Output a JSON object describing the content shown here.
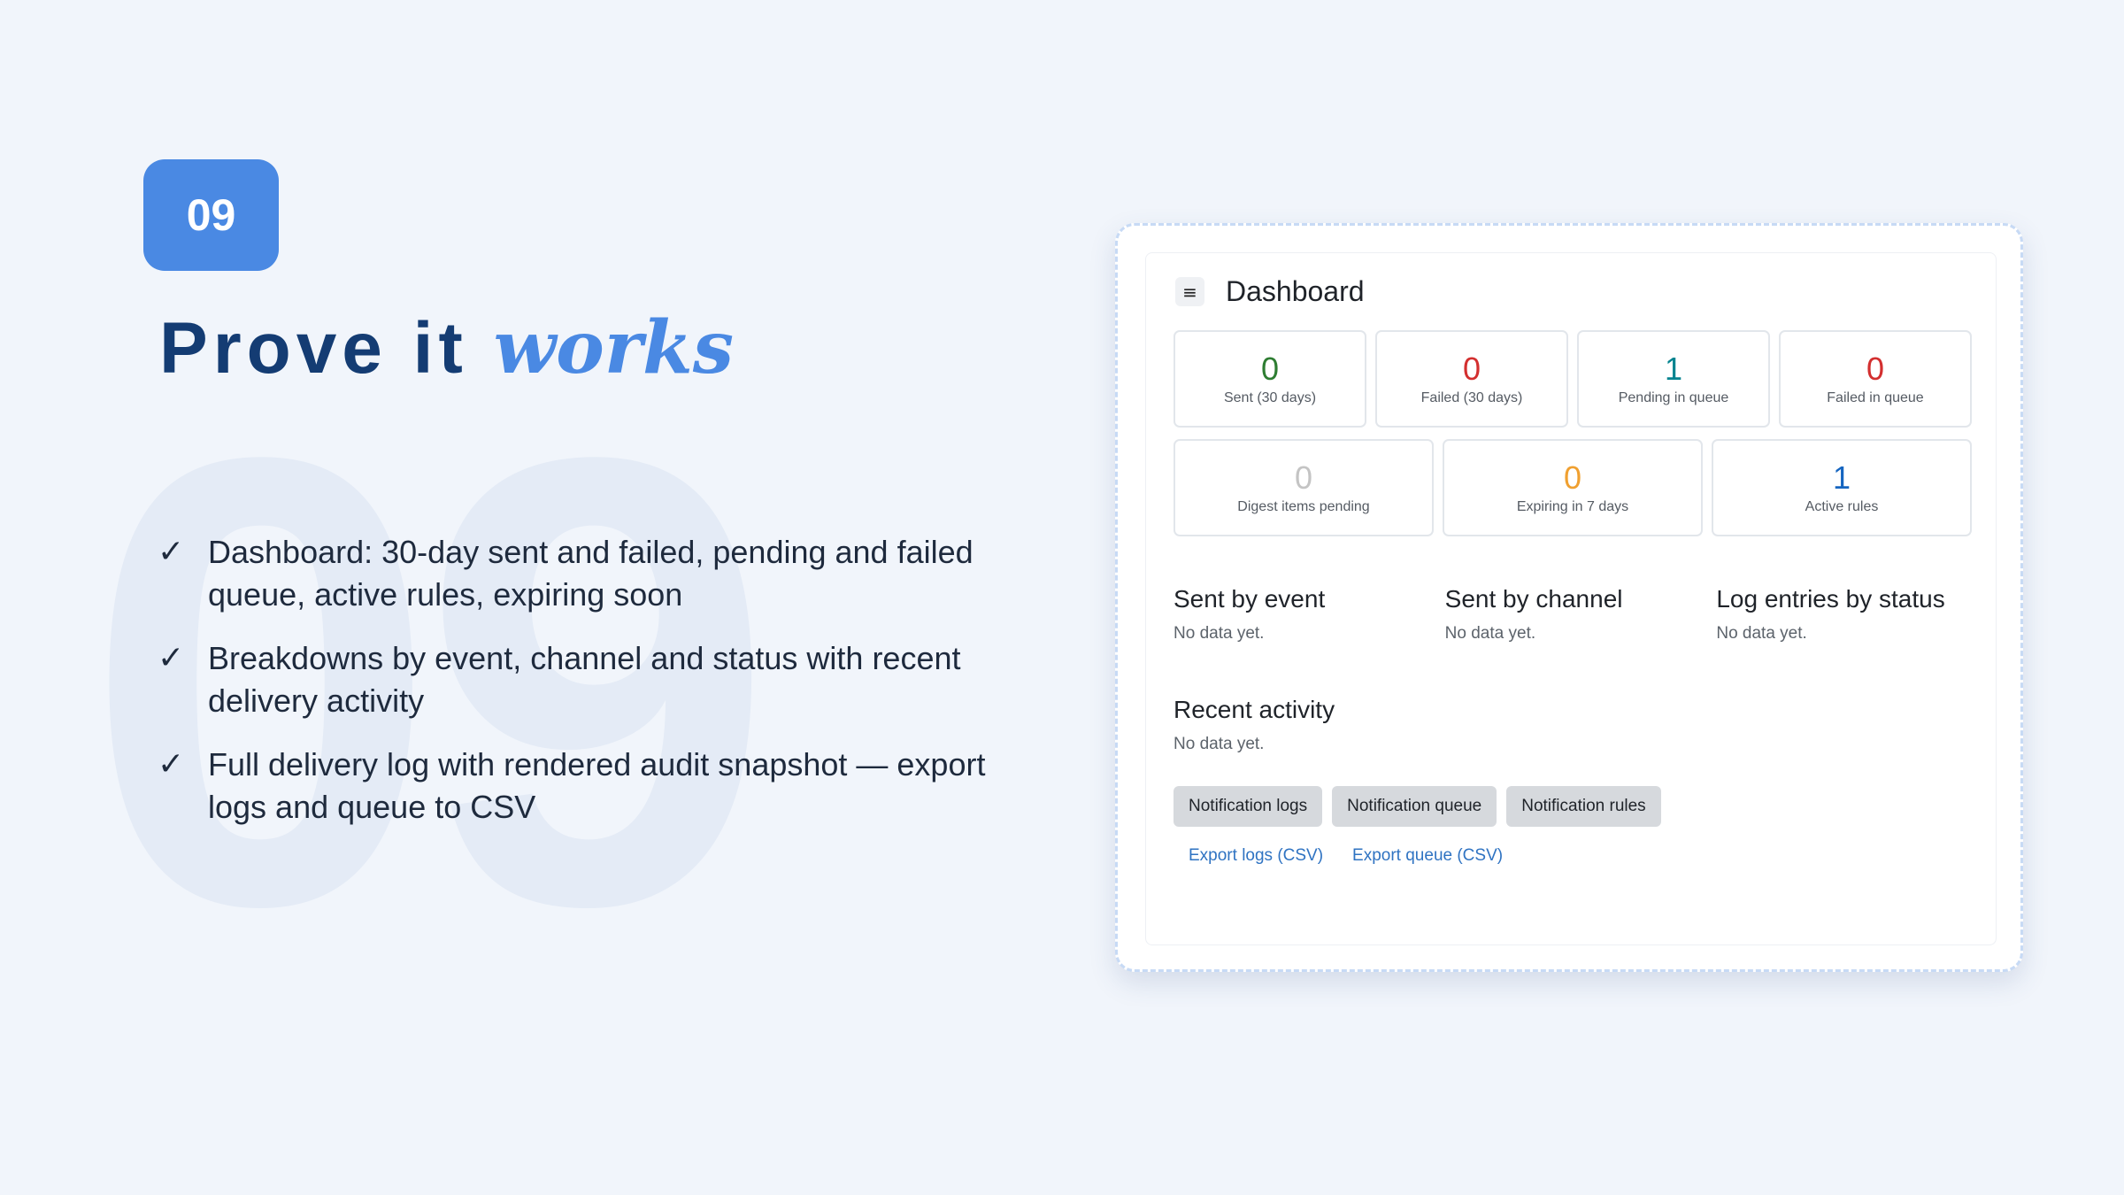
{
  "slide": {
    "number_badge": "09",
    "background_number": "09",
    "title_main": "Prove it ",
    "title_accent": "works",
    "bullets": [
      "Dashboard: 30-day sent and failed, pending and failed queue, active rules, expiring soon",
      "Breakdowns by event, channel and status with recent delivery activity",
      "Full delivery log with rendered audit snapshot — export logs and queue to CSV"
    ],
    "check_glyph": "✓"
  },
  "dashboard": {
    "menu_icon_glyph": "≡",
    "title": "Dashboard",
    "stats_row1": [
      {
        "value": "0",
        "label": "Sent (30 days)",
        "color": "#2e7d32"
      },
      {
        "value": "0",
        "label": "Failed (30 days)",
        "color": "#d32f2f"
      },
      {
        "value": "1",
        "label": "Pending in queue",
        "color": "#00838f"
      },
      {
        "value": "0",
        "label": "Failed in queue",
        "color": "#d32f2f"
      }
    ],
    "stats_row2": [
      {
        "value": "0",
        "label": "Digest items pending",
        "color": "#c4c4c4"
      },
      {
        "value": "0",
        "label": "Expiring in 7 days",
        "color": "#f0a030"
      },
      {
        "value": "1",
        "label": "Active rules",
        "color": "#1565c0"
      }
    ],
    "breakdowns": [
      {
        "heading": "Sent by event",
        "empty": "No data yet."
      },
      {
        "heading": "Sent by channel",
        "empty": "No data yet."
      },
      {
        "heading": "Log entries by status",
        "empty": "No data yet."
      }
    ],
    "recent_activity": {
      "heading": "Recent activity",
      "empty": "No data yet."
    },
    "buttons": [
      "Notification logs",
      "Notification queue",
      "Notification rules"
    ],
    "links": [
      "Export logs (CSV)",
      "Export queue (CSV)"
    ]
  }
}
